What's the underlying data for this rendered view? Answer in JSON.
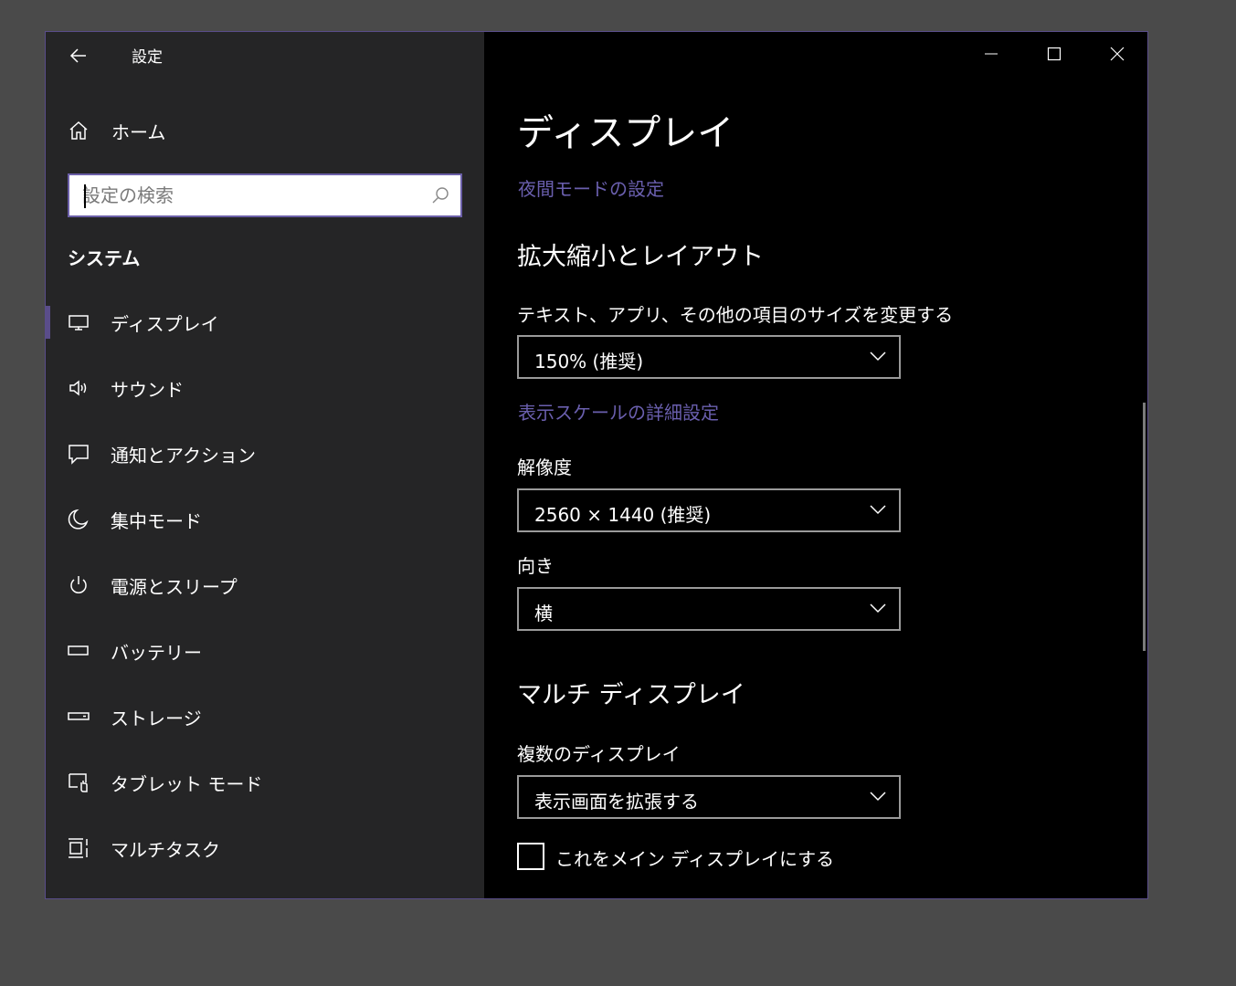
{
  "window": {
    "title": "設定"
  },
  "sidebar": {
    "home_label": "ホーム",
    "search_placeholder": "設定の検索",
    "section_title": "システム",
    "selected": "ディスプレイ",
    "items": [
      {
        "label": "ディスプレイ",
        "icon": "monitor-icon"
      },
      {
        "label": "サウンド",
        "icon": "speaker-icon"
      },
      {
        "label": "通知とアクション",
        "icon": "message-icon"
      },
      {
        "label": "集中モード",
        "icon": "moon-icon"
      },
      {
        "label": "電源とスリープ",
        "icon": "power-icon"
      },
      {
        "label": "バッテリー",
        "icon": "battery-icon"
      },
      {
        "label": "ストレージ",
        "icon": "storage-icon"
      },
      {
        "label": "タブレット モード",
        "icon": "tablet-mode-icon"
      },
      {
        "label": "マルチタスク",
        "icon": "multitask-icon"
      }
    ]
  },
  "main": {
    "page_title": "ディスプレイ",
    "night_light_link": "夜間モードの設定",
    "scale_section_title": "拡大縮小とレイアウト",
    "scale_label": "テキスト、アプリ、その他の項目のサイズを変更する",
    "scale_value": "150% (推奨)",
    "advanced_scaling_link": "表示スケールの詳細設定",
    "resolution_label": "解像度",
    "resolution_value": "2560 × 1440 (推奨)",
    "orientation_label": "向き",
    "orientation_value": "横",
    "multi_display_title": "マルチ ディスプレイ",
    "multiple_displays_label": "複数のディスプレイ",
    "multiple_displays_value": "表示画面を拡張する",
    "make_main_label": "これをメイン ディスプレイにする",
    "make_main_checked": false
  },
  "colors": {
    "accent": "#5a4d8a",
    "link": "#6a5fae",
    "sidebar_bg": "#252526",
    "content_bg": "#000000",
    "desktop_bg": "#4a4a4a"
  }
}
